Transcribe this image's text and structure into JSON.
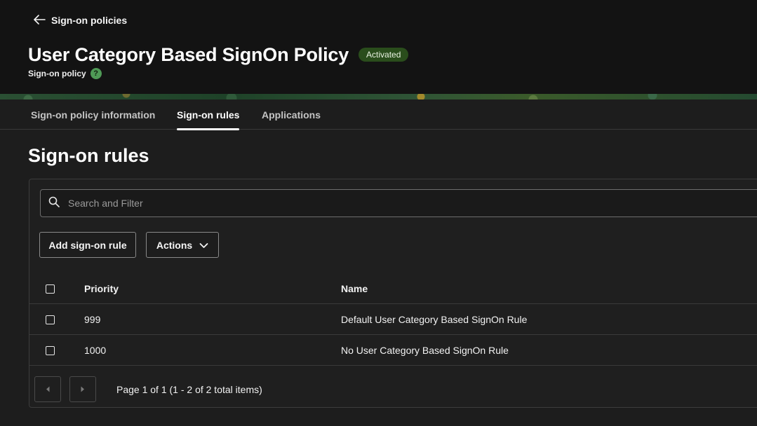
{
  "header": {
    "back_label": "Sign-on policies",
    "title": "User Category Based SignOn Policy",
    "status": "Activated",
    "subtitle": "Sign-on policy",
    "help_glyph": "?"
  },
  "tabs": [
    {
      "label": "Sign-on policy information",
      "active": false
    },
    {
      "label": "Sign-on rules",
      "active": true
    },
    {
      "label": "Applications",
      "active": false
    }
  ],
  "section": {
    "title": "Sign-on rules"
  },
  "search": {
    "placeholder": "Search and Filter",
    "value": ""
  },
  "toolbar": {
    "add_label": "Add sign-on rule",
    "actions_label": "Actions"
  },
  "table": {
    "columns": {
      "priority": "Priority",
      "name": "Name"
    },
    "rows": [
      {
        "priority": "999",
        "name": "Default User Category Based SignOn Rule"
      },
      {
        "priority": "1000",
        "name": "No User Category Based SignOn Rule"
      }
    ]
  },
  "pagination": {
    "text": "Page 1 of 1 (1 - 2 of 2 total items)"
  },
  "icons": {
    "back": "arrow-left-icon",
    "help": "help-icon",
    "search": "search-icon",
    "dropdown": "chevron-down-icon",
    "prev": "chevron-left-icon",
    "next": "chevron-right-icon"
  },
  "colors": {
    "status_badge_bg": "#2a4d1c",
    "help_icon": "#4f9a56",
    "background": "#1d1d1d"
  }
}
